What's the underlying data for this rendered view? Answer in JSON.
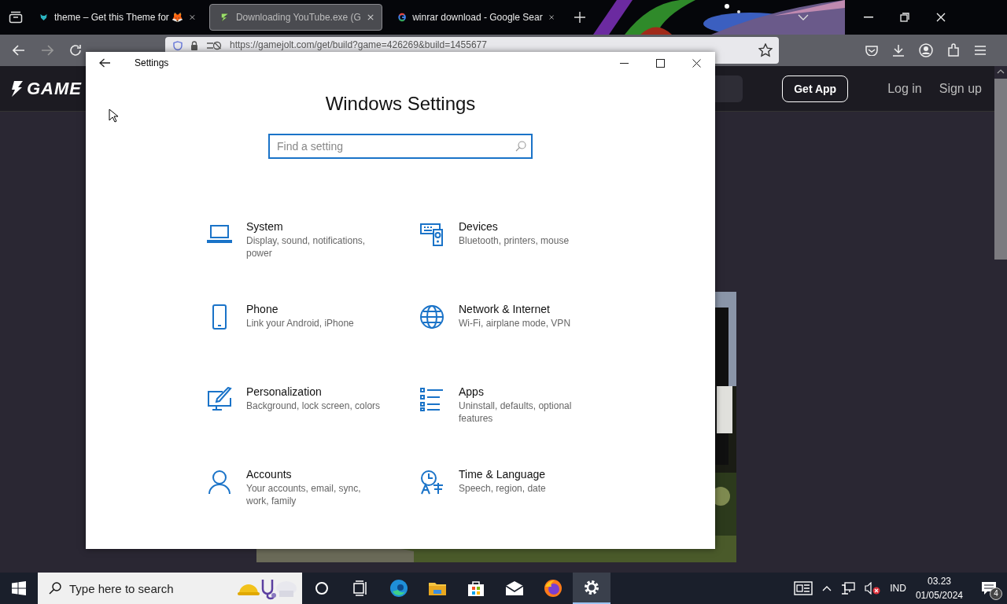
{
  "browser": {
    "tabs": [
      {
        "title": "theme – Get this Theme for 🦊",
        "kind": "wolf",
        "selected": false
      },
      {
        "title": "Downloading YouTube.exe (G",
        "kind": "bolt",
        "selected": true
      },
      {
        "title": "winrar download - Google Sear",
        "kind": "google",
        "selected": false
      }
    ],
    "url": "https://gamejolt.com/get/build?game=426269&build=1455677",
    "site_header": {
      "logo": "GAME",
      "button": "Get App",
      "links": [
        "Log in",
        "Sign up"
      ]
    }
  },
  "settings_window": {
    "title": "Settings",
    "heading": "Windows Settings",
    "search": {
      "placeholder": "Find a setting"
    },
    "categories": [
      {
        "kind": "laptop",
        "name": "System",
        "description": "Display, sound, notifications, power"
      },
      {
        "kind": "devices",
        "name": "Devices",
        "description": "Bluetooth, printers, mouse"
      },
      {
        "kind": "phone",
        "name": "Phone",
        "description": "Link your Android, iPhone"
      },
      {
        "kind": "globe",
        "name": "Network & Internet",
        "description": "Wi-Fi, airplane mode, VPN"
      },
      {
        "kind": "paint",
        "name": "Personalization",
        "description": "Background, lock screen, colors"
      },
      {
        "kind": "apps",
        "name": "Apps",
        "description": "Uninstall, defaults, optional features"
      },
      {
        "kind": "person",
        "name": "Accounts",
        "description": "Your accounts, email, sync, work, family"
      },
      {
        "kind": "time",
        "name": "Time & Language",
        "description": "Speech, region, date"
      }
    ]
  },
  "taskbar": {
    "search_placeholder": "Type here to search",
    "apps": [
      {
        "kind": "cortana",
        "selected": false
      },
      {
        "kind": "taskview",
        "selected": false
      },
      {
        "kind": "edge",
        "selected": false
      },
      {
        "kind": "explorer",
        "selected": false
      },
      {
        "kind": "store",
        "selected": false
      },
      {
        "kind": "mail",
        "selected": false
      },
      {
        "kind": "firefox",
        "selected": false
      },
      {
        "kind": "settings",
        "selected": true
      }
    ],
    "language": "IND",
    "time": "03.23",
    "date": "01/05/2024",
    "notification_count": "4"
  }
}
